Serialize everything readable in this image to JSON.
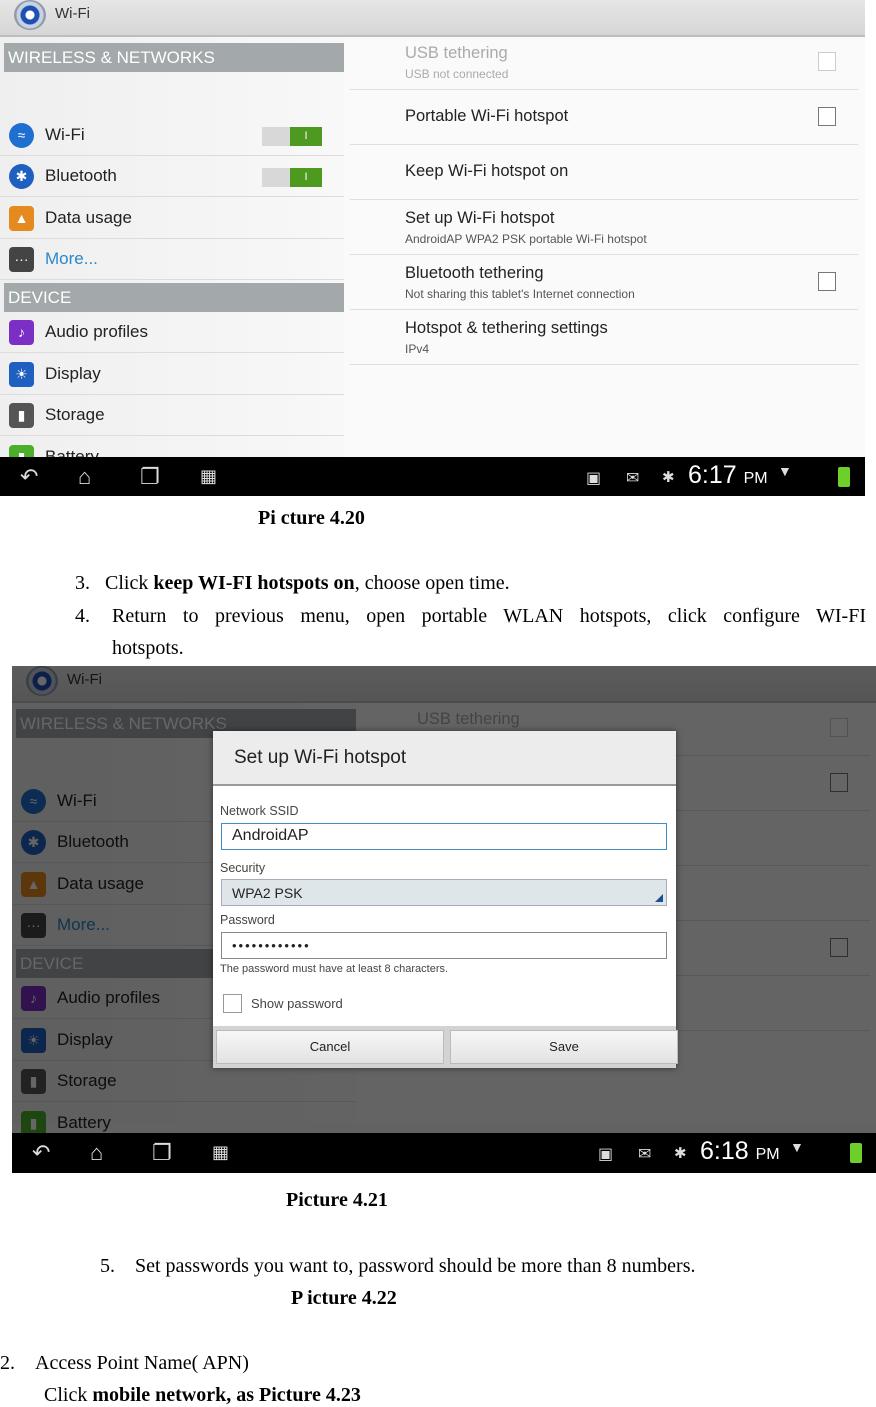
{
  "settings": {
    "app_title": "Wi-Fi",
    "section_wireless": "WIRELESS & NETWORKS",
    "section_device": "DEVICE",
    "left_items": [
      {
        "label": "Wi-Fi",
        "icon": "wifi-icon",
        "toggle": "I",
        "toggle_on": true
      },
      {
        "label": "Bluetooth",
        "icon": "bluetooth-icon",
        "toggle": "I",
        "toggle_on": true
      },
      {
        "label": "Data usage",
        "icon": "data-usage-icon"
      },
      {
        "label": "More...",
        "icon": "more-icon",
        "selected": true
      },
      {
        "label": "Audio profiles",
        "icon": "audio-icon"
      },
      {
        "label": "Display",
        "icon": "display-icon"
      },
      {
        "label": "Storage",
        "icon": "storage-icon"
      },
      {
        "label": "Battery",
        "icon": "battery-icon"
      }
    ],
    "right_items": [
      {
        "title": "USB tethering",
        "subtitle": "USB not connected",
        "checkbox": true,
        "disabled": true
      },
      {
        "title": "Portable Wi-Fi hotspot",
        "checkbox": true
      },
      {
        "title": "Keep Wi-Fi hotspot on"
      },
      {
        "title": "Set up Wi-Fi hotspot",
        "subtitle": "AndroidAP WPA2 PSK portable Wi-Fi hotspot"
      },
      {
        "title": "Bluetooth tethering",
        "subtitle": "Not sharing this tablet's Internet connection",
        "checkbox": true
      },
      {
        "title": "Hotspot & tethering settings",
        "subtitle": "IPv4"
      }
    ]
  },
  "screen1": {
    "time": "6:17",
    "ampm": "PM"
  },
  "screen2": {
    "time": "6:18",
    "ampm": "PM",
    "dialog": {
      "title": "Set up Wi-Fi hotspot",
      "ssid_label": "Network SSID",
      "ssid_value": "AndroidAP",
      "security_label": "Security",
      "security_value": "WPA2 PSK",
      "password_label": "Password",
      "password_value": "••••••••••••",
      "hint": "The password must have at least 8 characters.",
      "show_password": "Show password",
      "show_password_checked": false,
      "cancel": "Cancel",
      "save": "Save"
    }
  },
  "document": {
    "caption1": "Pi cture 4.20",
    "step3_num": "3.",
    "step3_pre": "Click ",
    "step3_bold": "keep WI-FI hotspots on",
    "step3_post": ", choose open time.",
    "step4_num": "4.",
    "step4_line1": "Return  to  previous  menu,  open  portable  WLAN  hotspots,  click  configure  WI-FI",
    "step4_line2": "hotspots.",
    "caption2": "Picture 4.21",
    "step5_num": "5.",
    "step5": "Set passwords you want to, password should be more than 8 numbers.",
    "caption3": "P icture 4.22",
    "sec2_num": "2.",
    "sec2_title": "Access Point Name( APN)",
    "sec2_pre": "Click ",
    "sec2_bold": "mobile network, as Picture 4.23"
  }
}
